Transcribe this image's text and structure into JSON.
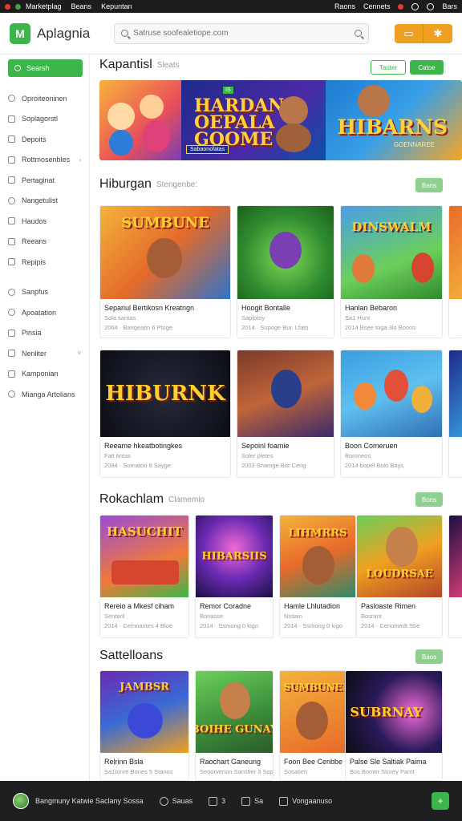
{
  "status_bar": {
    "app_label": "Marketplag",
    "left_items": [
      "Beans",
      "Kepuntan"
    ],
    "right_items": [
      "Raons",
      "Cennets",
      "Bars"
    ]
  },
  "header": {
    "logo_letter": "M",
    "brand": "Aplagnia",
    "search_placeholder": "Satruse soofealetiope.com",
    "btn_1_icon": "tag-icon",
    "btn_2_icon": "gear-icon"
  },
  "sidebar": {
    "search_label": "Searsh",
    "items": [
      {
        "label": "Oproiteoninen",
        "icon": "home-icon"
      },
      {
        "label": "Soplagorstl",
        "icon": "grid-icon"
      },
      {
        "label": "Depoits",
        "icon": "chart-icon"
      },
      {
        "label": "Rottmosenbles",
        "icon": "folder-icon",
        "chevron": "›"
      },
      {
        "label": "Pertaginat",
        "icon": "list-icon"
      },
      {
        "label": "Nangetulist",
        "icon": "pin-icon"
      },
      {
        "label": "Haudos",
        "icon": "flag-icon"
      },
      {
        "label": "Reeans",
        "icon": "doc-icon"
      },
      {
        "label": "Repipis",
        "icon": "box-icon"
      },
      {
        "label": "Sanpfus",
        "icon": "circle-icon"
      },
      {
        "label": "Apoatation",
        "icon": "circle-icon"
      },
      {
        "label": "Pinsia",
        "icon": "square-icon"
      },
      {
        "label": "Nenliter",
        "icon": "mail-icon",
        "chevron": "˅"
      },
      {
        "label": "Kamponian",
        "icon": "card-icon"
      },
      {
        "label": "Mianga Artolians",
        "icon": "ring-icon"
      }
    ]
  },
  "sections": {
    "featured": {
      "title": "Kapantisl",
      "subtitle": "Sieats",
      "btn_outline": "Tauter",
      "btn_solid": "Catoe",
      "banner_title": "HARDAN OEPALA GOOME",
      "banner_title_right": "HIBARNS",
      "banner_sub_right": "GOENNAREE",
      "banner_tag": "Sabaonofatas",
      "banner_badge": "IS"
    },
    "hiburgan": {
      "title": "Hiburgan",
      "subtitle": "Stengenbe:",
      "more": "Bans",
      "cards": [
        {
          "word": "SUMBUNE",
          "title": "Separiul Bertikosn Kreatngn",
          "meta1": "Sola tiantas",
          "meta2": "2064 · Bangeatin 6 Ptoge"
        },
        {
          "word": "",
          "title": "Hoogit Bontalle",
          "meta1": "Saplotoy",
          "meta2": "2014 · Sopoge Bur. Lfato"
        },
        {
          "word": "DINSWALM",
          "title": "Hanlan Bebaron",
          "meta1": "Sa1 Hunt",
          "meta2": "2014 Bsee toga 3lo Boons"
        },
        {
          "word": "HIBURNK",
          "title": "Reeame hkeatbotingkes",
          "meta1": "Fatt tintas",
          "meta2": "2084 · Somaton 8 Sayge"
        },
        {
          "word": "",
          "title": "Sepoinl foamie",
          "meta1": "Soler pletes",
          "meta2": "2003 Snamge Bor Ceng"
        },
        {
          "word": "",
          "title": "Boon Comeruen",
          "meta1": "Boroneos",
          "meta2": "2014 bopel Bolo Bays"
        }
      ]
    },
    "rokachlam": {
      "title": "Rokachlam",
      "subtitle": "Clamemio",
      "more": "Bons",
      "cards": [
        {
          "word": "HASUCHIT",
          "title": "Rereio a Mkesf ciham",
          "meta1": "Sentanl",
          "meta2": "2014 · Cemnantes 4 Bloe"
        },
        {
          "word": "HIBARSIIS",
          "title": "Remor Coradne",
          "meta1": "Bonasse",
          "meta2": "2014 · Ssmong 0 kigo"
        },
        {
          "word": "LIHMRRS",
          "title": "Hamle Lhlutadion",
          "meta1": "Nistain",
          "meta2": "2014 · Ssmong 0 kigo"
        },
        {
          "word": "LOUDRSAE",
          "title": "Pasloaste Rimen",
          "meta1": "Bosrant",
          "meta2": "2014 · Cenomedt Sbe"
        }
      ]
    },
    "sattelloans": {
      "title": "Sattelloans",
      "more": "Baos",
      "cards": [
        {
          "word": "JAMBSR",
          "title": "Relrinn Bsla",
          "meta1": "Sa1tonre Bones 5 Stanos",
          "meta2": ""
        },
        {
          "word": "BOIHE GUNAY",
          "title": "Raochart Ganeung",
          "meta1": "Seoorvenon Sanstier 3 Sopa",
          "meta2": ""
        },
        {
          "word": "SUMBUNE",
          "title": "Foon Bee Cenbbe",
          "meta1": "Sosatien",
          "meta2": ""
        },
        {
          "word": "SUBRNAY",
          "title": "Palse Sle Saltiak Paima",
          "meta1": "Bos Bomer Storey Parnt",
          "meta2": ""
        }
      ]
    }
  },
  "bottom_bar": {
    "user_text": "Bangmuny Katwie Saclany Sossa",
    "items": [
      {
        "label": "Sauas",
        "icon": "clock-icon"
      },
      {
        "label": "3",
        "icon": "bookmark-icon"
      },
      {
        "label": "Sa",
        "icon": "grid-icon"
      },
      {
        "label": "Vongaanuso",
        "icon": "layers-icon"
      }
    ],
    "fab_label": "+"
  },
  "colors": {
    "accent": "#3cb54a",
    "orange": "#f0a020",
    "dark": "#1f1f22"
  }
}
